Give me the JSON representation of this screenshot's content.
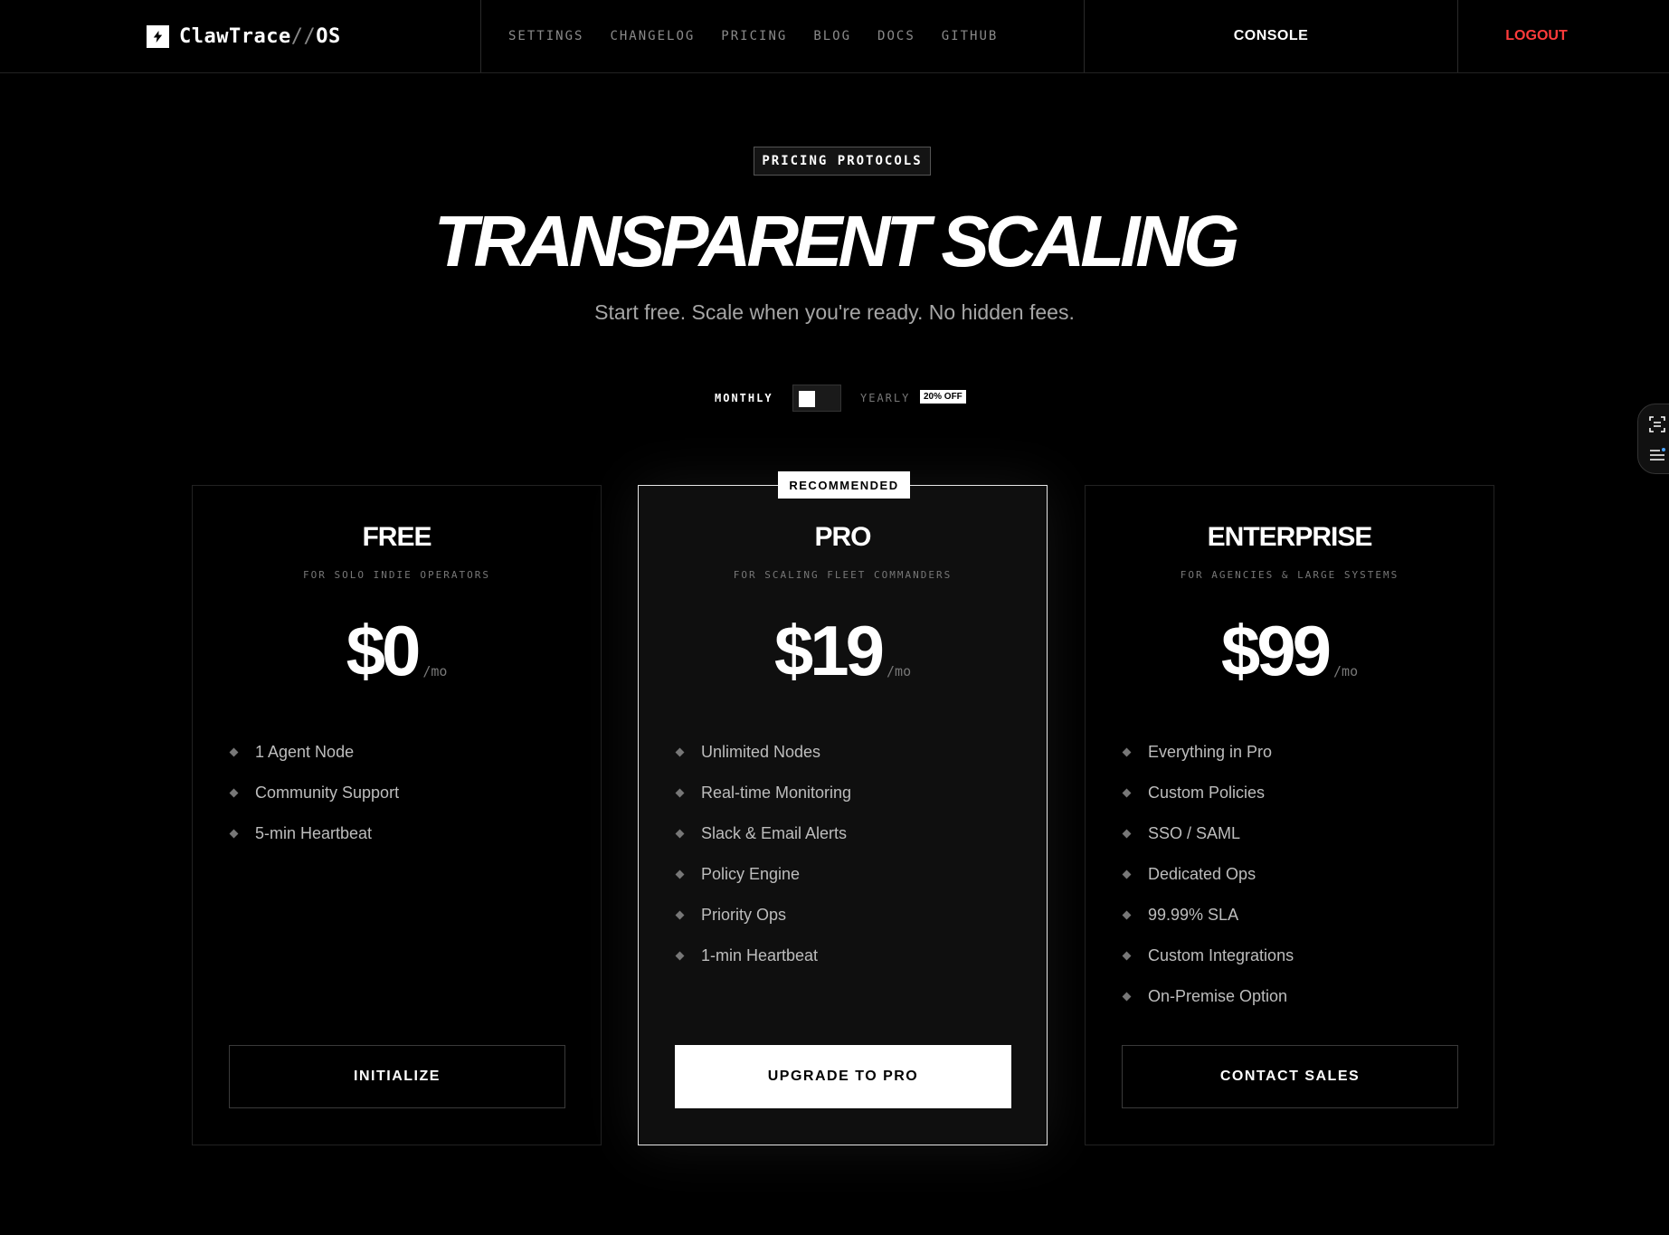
{
  "header": {
    "brand": {
      "name": "ClawTrace",
      "slash": "//",
      "suffix": "OS"
    },
    "nav": [
      "SETTINGS",
      "CHANGELOG",
      "PRICING",
      "BLOG",
      "DOCS",
      "GITHUB"
    ],
    "console": "CONSOLE",
    "logout": "LOGOUT"
  },
  "hero": {
    "tag": "PRICING PROTOCOLS",
    "title": "TRANSPARENT SCALING",
    "subtitle": "Start free. Scale when you're ready. No hidden fees."
  },
  "billing": {
    "monthly": "MONTHLY",
    "yearly": "YEARLY",
    "discount": "20% OFF",
    "selected": "monthly"
  },
  "plans": [
    {
      "name": "FREE",
      "desc": "FOR SOLO INDIE OPERATORS",
      "price": "$0",
      "per": "/mo",
      "features": [
        "1 Agent Node",
        "Community Support",
        "5-min Heartbeat"
      ],
      "cta": "INITIALIZE"
    },
    {
      "name": "PRO",
      "badge": "RECOMMENDED",
      "desc": "FOR SCALING FLEET COMMANDERS",
      "price": "$19",
      "per": "/mo",
      "features": [
        "Unlimited Nodes",
        "Real-time Monitoring",
        "Slack & Email Alerts",
        "Policy Engine",
        "Priority Ops",
        "1-min Heartbeat"
      ],
      "cta": "UPGRADE TO PRO"
    },
    {
      "name": "ENTERPRISE",
      "desc": "FOR AGENCIES & LARGE SYSTEMS",
      "price": "$99",
      "per": "/mo",
      "features": [
        "Everything in Pro",
        "Custom Policies",
        "SSO / SAML",
        "Dedicated Ops",
        "99.99% SLA",
        "Custom Integrations",
        "On-Premise Option"
      ],
      "cta": "CONTACT SALES"
    }
  ],
  "icons": {
    "logo": "bolt-icon",
    "side": [
      "scan-icon",
      "list-icon"
    ]
  },
  "colors": {
    "accent": "#ffffff",
    "logout": "#ff3b3b",
    "background": "#000000"
  }
}
